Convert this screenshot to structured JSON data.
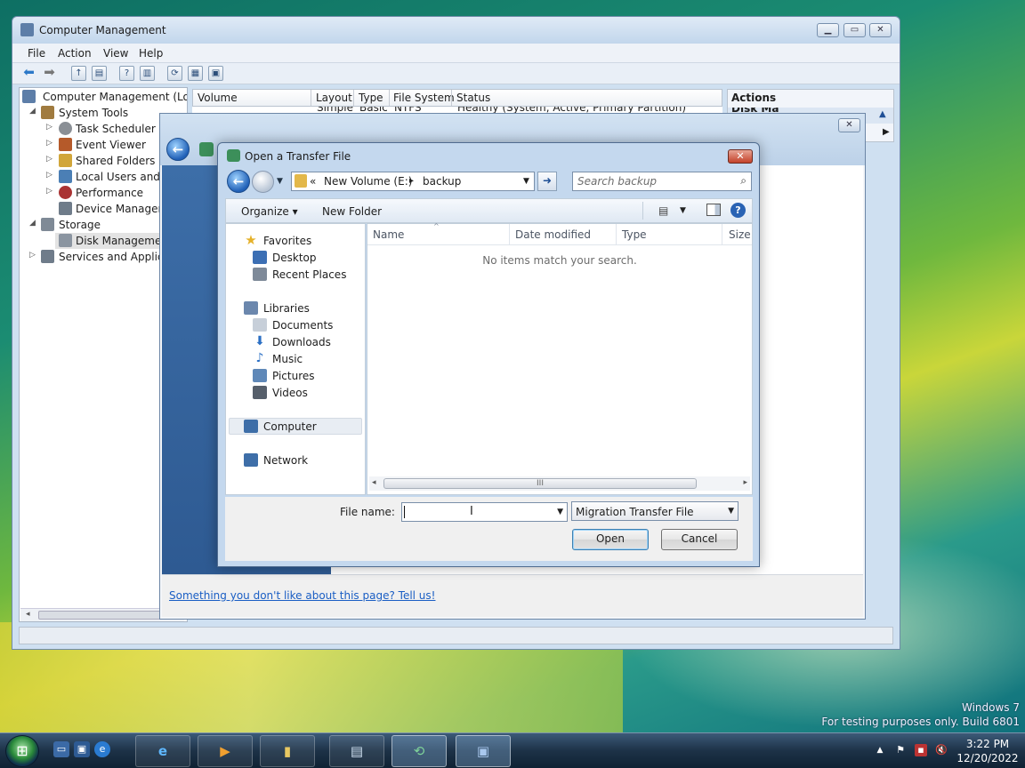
{
  "computer_management": {
    "title": "Computer Management",
    "menu": [
      "File",
      "Action",
      "View",
      "Help"
    ],
    "tree": [
      {
        "label": "Computer Management (Local",
        "level": 0,
        "expander": ""
      },
      {
        "label": "System Tools",
        "level": 1,
        "expander": "◢"
      },
      {
        "label": "Task Scheduler",
        "level": 2,
        "expander": "▷"
      },
      {
        "label": "Event Viewer",
        "level": 2,
        "expander": "▷"
      },
      {
        "label": "Shared Folders",
        "level": 2,
        "expander": "▷"
      },
      {
        "label": "Local Users and G",
        "level": 2,
        "expander": "▷"
      },
      {
        "label": "Performance",
        "level": 2,
        "expander": "▷"
      },
      {
        "label": "Device Manager",
        "level": 2,
        "expander": ""
      },
      {
        "label": "Storage",
        "level": 1,
        "expander": "◢"
      },
      {
        "label": "Disk Management",
        "level": 2,
        "expander": ""
      },
      {
        "label": "Services and Applicat",
        "level": 1,
        "expander": "▷"
      }
    ],
    "columns": [
      "Volume",
      "Layout",
      "Type",
      "File System",
      "Status"
    ],
    "partial_row": [
      "Simple",
      "Basic",
      "NTFS",
      "Healthy (System, Active, Primary Partition)"
    ],
    "actions_title": "Actions",
    "actions_partial": "Disk Ma"
  },
  "easy_transfer": {
    "feedback_link": "Something you don't like about this page? Tell us!"
  },
  "open_dialog": {
    "title": "Open a Transfer File",
    "breadcrumb": [
      "«",
      "New Volume (E:)",
      "▸",
      "backup"
    ],
    "search_placeholder": "Search backup",
    "organize": "Organize ▾",
    "new_folder": "New Folder",
    "nav": {
      "favorites": "Favorites",
      "desktop": "Desktop",
      "recent_places": "Recent Places",
      "libraries": "Libraries",
      "documents": "Documents",
      "downloads": "Downloads",
      "music": "Music",
      "pictures": "Pictures",
      "videos": "Videos",
      "computer": "Computer",
      "network": "Network"
    },
    "columns": [
      "Name",
      "Date modified",
      "Type",
      "Size"
    ],
    "empty_message": "No items match your search.",
    "file_name_label": "File name:",
    "file_name_value": "",
    "file_type": "Migration Transfer File",
    "open_button": "Open",
    "cancel_button": "Cancel"
  },
  "desktop": {
    "watermark_line1": "Windows 7",
    "watermark_line2": "For testing purposes only. Build 6801"
  },
  "taskbar": {
    "time": "3:22 PM",
    "date": "12/20/2022"
  }
}
